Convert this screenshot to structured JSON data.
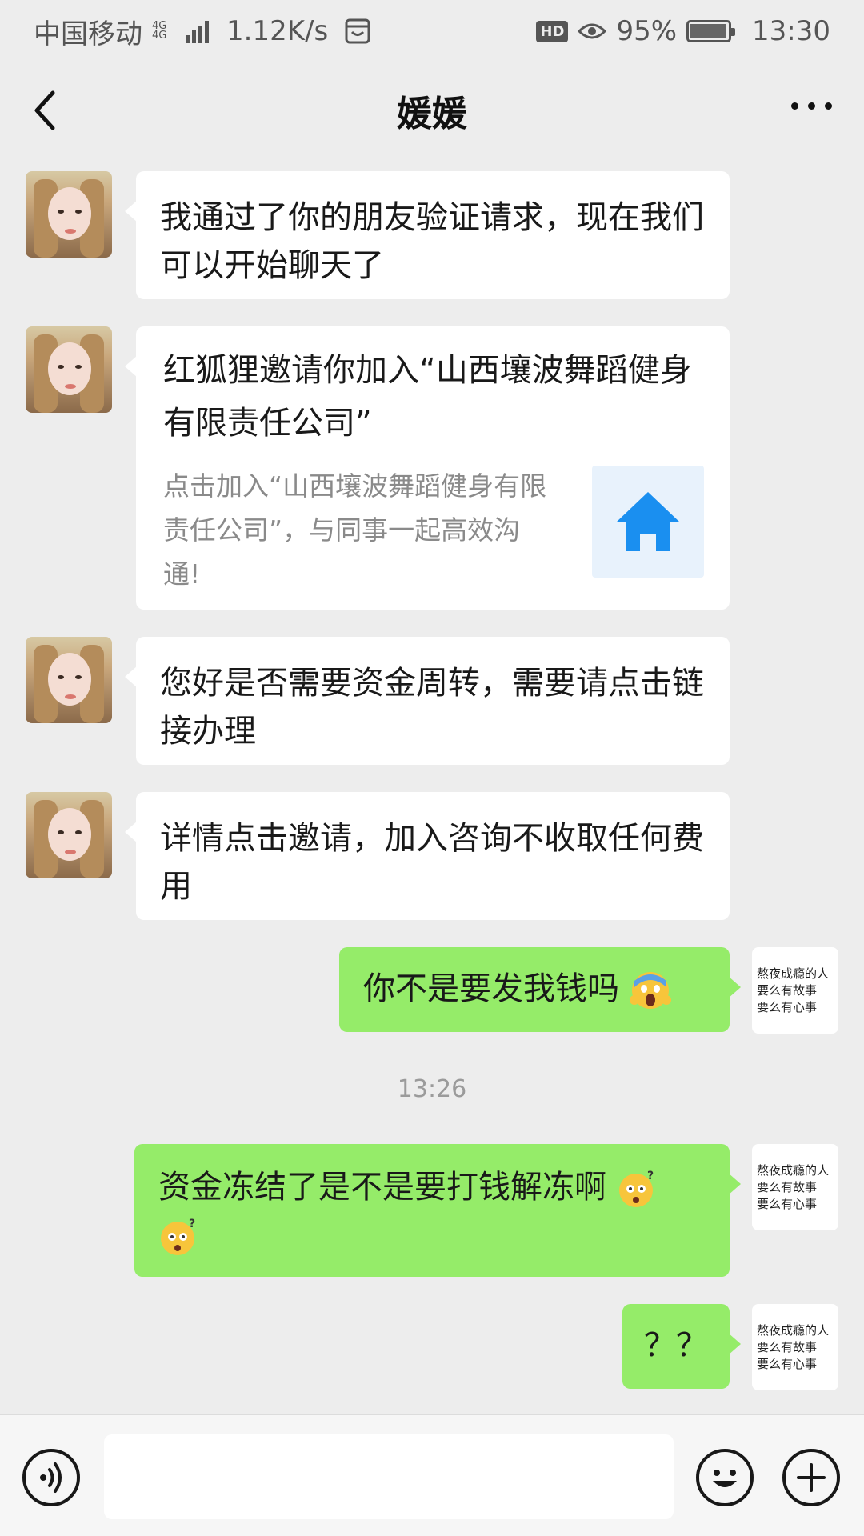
{
  "status_bar": {
    "carrier": "中国移动",
    "network_tiny": "4G 4G",
    "speed": "1.12K/s",
    "hd_badge": "HD",
    "battery_text": "95%",
    "battery_level": 0.95,
    "time": "13:30"
  },
  "nav": {
    "title": "媛媛",
    "back_icon": "chevron-left-icon",
    "more_icon": "more-dots-icon"
  },
  "messages": [
    {
      "side": "left",
      "text": "我通过了你的朋友验证请求，现在我们可以开始聊天了"
    },
    {
      "side": "left",
      "type": "card",
      "title": "红狐狸邀请你加入“山西壤波舞蹈健身有限责任公司”",
      "desc": "点击加入“山西壤波舞蹈健身有限责任公司”，与同事一起高效沟通!",
      "icon": "home-icon"
    },
    {
      "side": "left",
      "text": "您好是否需要资金周转，需要请点击链接办理"
    },
    {
      "side": "left",
      "text": "详情点击邀请，加入咨询不收取任何费用"
    },
    {
      "side": "right",
      "text": "你不是要发我钱吗",
      "emoji": "screaming-face-emoji"
    },
    {
      "type": "timestamp",
      "text": "13:26"
    },
    {
      "side": "right",
      "text": "资金冻结了是不是要打钱解冻啊",
      "emoji": "flushed-question-emoji"
    },
    {
      "side": "right",
      "text": "？？"
    }
  ],
  "self_avatar_text": [
    "熬夜成瘾的人",
    "要么有故事",
    "要么有心事"
  ],
  "input_bar": {
    "voice_icon": "voice-icon",
    "emoji_icon": "smiley-icon",
    "plus_icon": "plus-icon",
    "placeholder": ""
  },
  "colors": {
    "background": "#ededed",
    "bubble_self": "#95ec69",
    "bubble_other": "#ffffff",
    "card_icon": "#1a8ff0"
  }
}
